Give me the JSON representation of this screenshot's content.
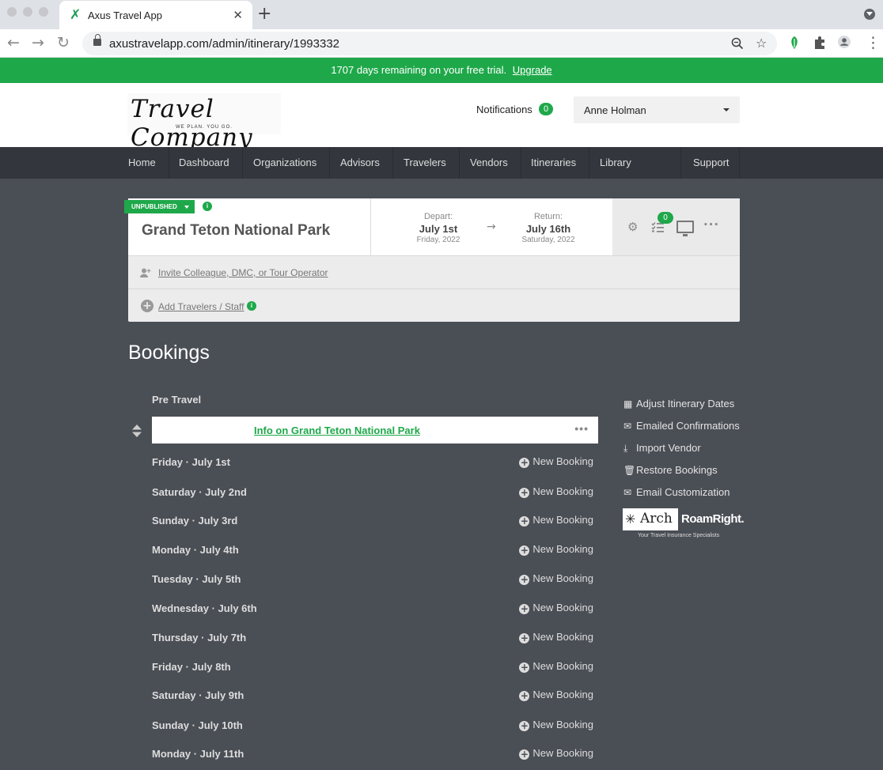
{
  "browser": {
    "tab_title": "Axus Travel App",
    "tab_close": "✕",
    "new_tab": "+",
    "url": "axustravelapp.com/admin/itinerary/1993332"
  },
  "trial": {
    "message": "1707 days remaining on your free trial.",
    "upgrade_label": "Upgrade"
  },
  "header": {
    "logo_script": "Travel Company",
    "logo_tagline": "WE PLAN. YOU GO.",
    "notifications_label": "Notifications",
    "notifications_count": "0",
    "user_name": "Anne Holman"
  },
  "nav": {
    "items": [
      "Home",
      "Dashboard",
      "Organizations",
      "Advisors",
      "Travelers",
      "Vendors",
      "Itineraries",
      "Library",
      "Support"
    ]
  },
  "itinerary": {
    "status": "UNPUBLISHED",
    "title": "Grand Teton National Park",
    "depart_caption": "Depart:",
    "depart_date": "July 1st",
    "depart_sub": "Friday, 2022",
    "return_caption": "Return:",
    "return_date": "July 16th",
    "return_sub": "Saturday, 2022",
    "arrow": "→",
    "checklist_count": "0",
    "invite_label": "Invite Colleague, DMC, or Tour Operator",
    "add_travelers_label": "Add Travelers / Staff"
  },
  "bookings": {
    "title": "Bookings",
    "section": "Pre Travel",
    "info_link": "Info on Grand Teton National Park",
    "new_booking_label": "New Booking",
    "days": [
      "Friday · July 1st",
      "Saturday · July 2nd",
      "Sunday · July 3rd",
      "Monday · July 4th",
      "Tuesday · July 5th",
      "Wednesday · July 6th",
      "Thursday · July 7th",
      "Friday · July 8th",
      "Saturday · July 9th",
      "Sunday · July 10th",
      "Monday · July 11th"
    ]
  },
  "side": {
    "links": [
      "Adjust Itinerary Dates",
      "Emailed Confirmations",
      "Import Vendor",
      "Restore Bookings",
      "Email Customization"
    ],
    "insurance_arch": "Arch",
    "insurance_roam": "RoamRight.",
    "insurance_tag": "Your Travel Insurance Specialists"
  },
  "colors": {
    "accent": "#1fa84a",
    "background": "#4a4e55",
    "nav": "#33373d"
  }
}
